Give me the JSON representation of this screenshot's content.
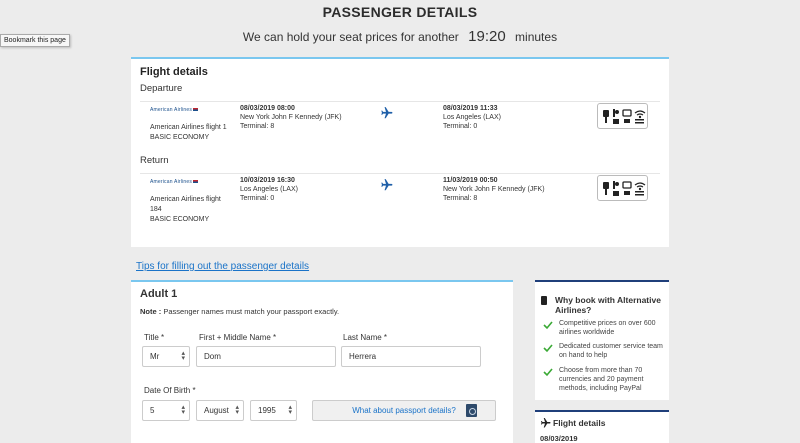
{
  "page": {
    "title": "PASSENGER DETAILS",
    "hold_text": "We can hold your seat prices for another",
    "timer": "19:20",
    "timer_unit": "minutes",
    "tooltip": "Bookmark this page"
  },
  "flight_details": {
    "title": "Flight details",
    "departure_label": "Departure",
    "return_label": "Return",
    "legs": [
      {
        "logo_text": "American Airlines",
        "airline": "American Airlines flight 1",
        "cabin": "BASIC ECONOMY",
        "dep_datetime": "08/03/2019 08:00",
        "dep_airport": "New York John F Kennedy (JFK)",
        "dep_terminal": "Terminal: 8",
        "arr_datetime": "08/03/2019 11:33",
        "arr_airport": "Los Angeles (LAX)",
        "arr_terminal": "Terminal: 0"
      },
      {
        "logo_text": "American Airlines",
        "airline": "American Airlines flight 184",
        "cabin": "BASIC ECONOMY",
        "dep_datetime": "10/03/2019 16:30",
        "dep_airport": "Los Angeles (LAX)",
        "dep_terminal": "Terminal: 0",
        "arr_datetime": "11/03/2019 00:50",
        "arr_airport": "New York John F Kennedy (JFK)",
        "arr_terminal": "Terminal: 8"
      }
    ]
  },
  "tips_link": "Tips for filling out the passenger details",
  "passenger": {
    "heading": "Adult 1",
    "note_label": "Note :",
    "note_text": "Passenger names must match your passport exactly.",
    "title_label": "Title *",
    "title_value": "Mr",
    "first_label": "First + Middle Name *",
    "first_value": "Dom",
    "last_label": "Last Name *",
    "last_value": "Herrera",
    "dob_label": "Date Of Birth *",
    "dob_day": "5",
    "dob_month": "August",
    "dob_year": "1995",
    "passport_link": "What about passport details?"
  },
  "why_book": {
    "title": "Why book with Alternative Airlines?",
    "items": [
      "Competitive prices on over 600 airlines worldwide",
      "Dedicated customer service team on hand to help",
      "Choose from more than 70 currencies and 20 payment methods, including PayPal"
    ]
  },
  "sidebar_flight": {
    "title": "Flight details",
    "date": "08/03/2019"
  },
  "colors": {
    "accent_blue": "#7ac7ef",
    "navy": "#1f3f7a",
    "link": "#1a73c8",
    "check_green": "#3aa935"
  }
}
